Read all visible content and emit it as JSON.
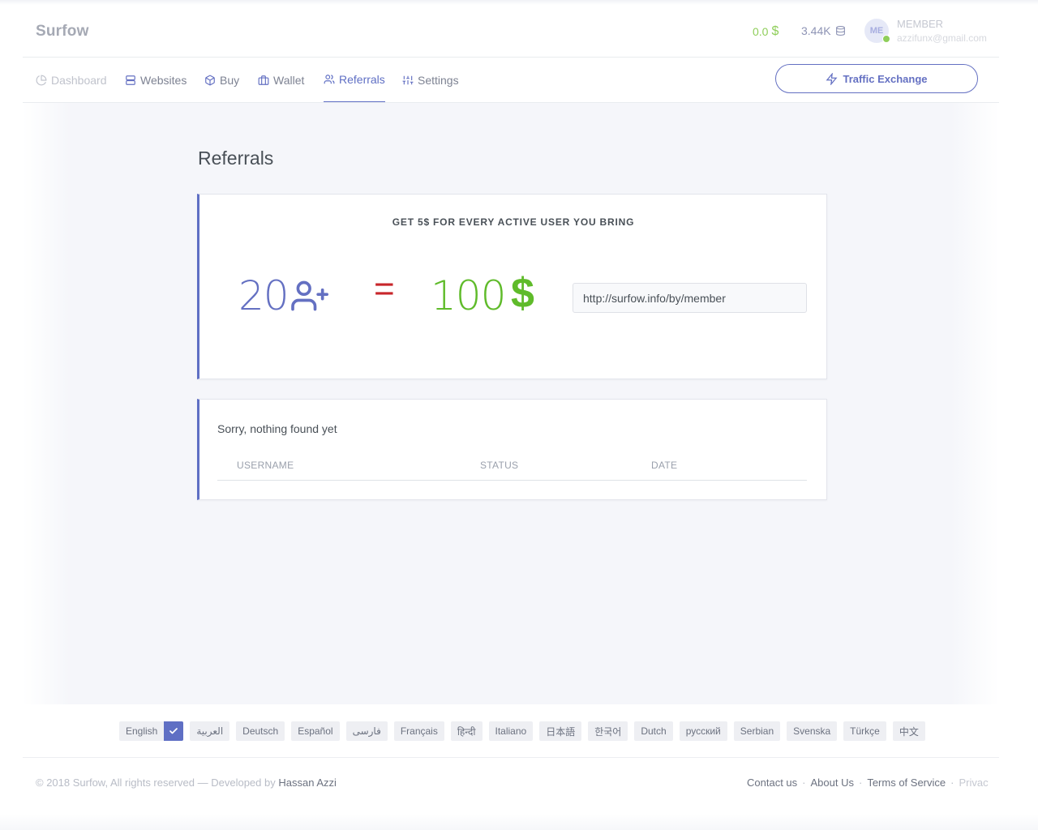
{
  "app": {
    "brand": "Surfow"
  },
  "header": {
    "balance": "0.0",
    "balance_icon": "dollar-icon",
    "credits": "3.44K",
    "credits_icon": "database-icon",
    "avatar_initials": "ME",
    "user_role": "MEMBER",
    "user_email": "azzifunx@gmail.com"
  },
  "nav": {
    "items": [
      {
        "label": "Dashboard",
        "icon": "pie-chart-icon"
      },
      {
        "label": "Websites",
        "icon": "server-icon"
      },
      {
        "label": "Buy",
        "icon": "box-icon"
      },
      {
        "label": "Wallet",
        "icon": "briefcase-icon"
      },
      {
        "label": "Referrals",
        "icon": "users-icon",
        "active": true
      },
      {
        "label": "Settings",
        "icon": "sliders-icon"
      }
    ],
    "traffic_exchange_label": "Traffic Exchange"
  },
  "page": {
    "title": "Referrals"
  },
  "referral_card": {
    "headline": "GET 5$ FOR EVERY ACTIVE USER YOU BRING",
    "user_count": "20",
    "equals": "=",
    "amount": "100",
    "currency": "$",
    "ref_link": "http://surfow.info/by/member"
  },
  "referrals_table": {
    "empty_message": "Sorry, nothing found yet",
    "columns": [
      "USERNAME",
      "STATUS",
      "DATE"
    ]
  },
  "languages": {
    "selected": "English",
    "items": [
      "العربية",
      "Deutsch",
      "Español",
      "فارسی",
      "Français",
      "हिन्दी",
      "Italiano",
      "日本語",
      "한국어",
      "Dutch",
      "русский",
      "Serbian",
      "Svenska",
      "Türkçe",
      "中文"
    ]
  },
  "footer": {
    "copyright": "© 2018 Surfow, All rights reserved — Developed by ",
    "developer": "Hassan Azzi",
    "links": [
      "Contact us",
      "About Us",
      "Terms of Service",
      "Privacy"
    ]
  },
  "colors": {
    "accent": "#5f6fc4",
    "success": "#5fbb2a",
    "danger": "#c8262b"
  }
}
